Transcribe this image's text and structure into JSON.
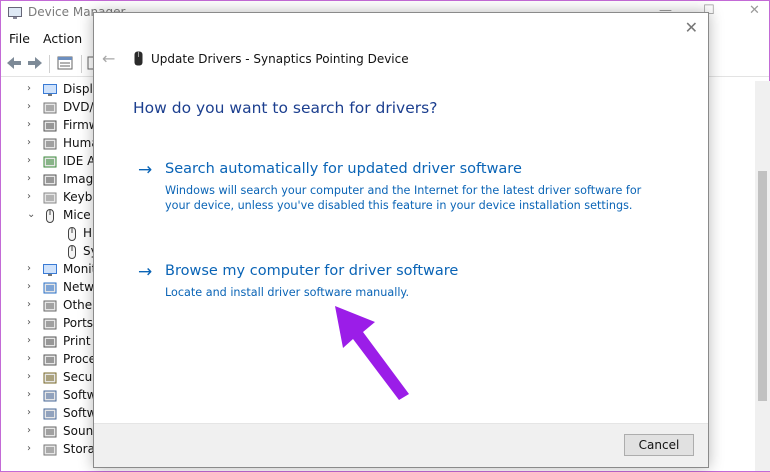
{
  "device_manager": {
    "title": "Device Manager",
    "window_controls": {
      "minimize": "—",
      "maximize": "☐",
      "close": "✕"
    },
    "menu": [
      "File",
      "Action"
    ],
    "tree": [
      {
        "label": "Displa",
        "icon": "display-adapter-icon",
        "expanded": false
      },
      {
        "label": "DVD/C",
        "icon": "dvd-drive-icon",
        "expanded": false
      },
      {
        "label": "Firmw",
        "icon": "firmware-icon",
        "expanded": false
      },
      {
        "label": "Huma",
        "icon": "hid-icon",
        "expanded": false
      },
      {
        "label": "IDE AT",
        "icon": "ide-controller-icon",
        "expanded": false
      },
      {
        "label": "Imagir",
        "icon": "imaging-device-icon",
        "expanded": false
      },
      {
        "label": "Keybo",
        "icon": "keyboard-icon",
        "expanded": false
      },
      {
        "label": "Mice a",
        "icon": "mouse-icon",
        "expanded": true
      },
      {
        "label": "HI",
        "icon": "mouse-icon",
        "child": true
      },
      {
        "label": "Sy",
        "icon": "mouse-icon",
        "child": true
      },
      {
        "label": "Monit",
        "icon": "monitor-icon",
        "expanded": false
      },
      {
        "label": "Netwo",
        "icon": "network-adapter-icon",
        "expanded": false
      },
      {
        "label": "Other",
        "icon": "other-devices-icon",
        "expanded": false
      },
      {
        "label": "Ports",
        "icon": "ports-icon",
        "expanded": false
      },
      {
        "label": "Print c",
        "icon": "print-queue-icon",
        "expanded": false
      },
      {
        "label": "Proces",
        "icon": "processor-icon",
        "expanded": false
      },
      {
        "label": "Securi",
        "icon": "security-device-icon",
        "expanded": false
      },
      {
        "label": "Softwa",
        "icon": "software-component-icon",
        "expanded": false
      },
      {
        "label": "Softwa",
        "icon": "software-device-icon",
        "expanded": false
      },
      {
        "label": "Sound",
        "icon": "sound-icon",
        "expanded": false
      },
      {
        "label": "Storag",
        "icon": "storage-icon",
        "expanded": false
      }
    ]
  },
  "dialog": {
    "title": "Update Drivers - Synaptics Pointing Device",
    "close": "✕",
    "back": "←",
    "question": "How do you want to search for drivers?",
    "options": [
      {
        "arrow": "→",
        "title": "Search automatically for updated driver software",
        "description": "Windows will search your computer and the Internet for the latest driver software for your device, unless you've disabled this feature in your device installation settings."
      },
      {
        "arrow": "→",
        "title": "Browse my computer for driver software",
        "description": "Locate and install driver software manually."
      }
    ],
    "cancel_label": "Cancel"
  },
  "colors": {
    "link_blue": "#0a64b6",
    "heading_blue": "#1c3f8f",
    "annotation_purple": "#9b1de8",
    "frame_border": "#c36ad6"
  }
}
